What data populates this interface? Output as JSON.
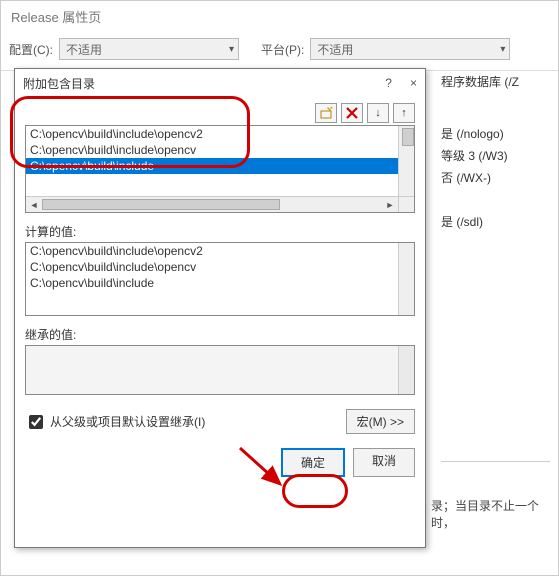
{
  "bg_window": {
    "title": "Release 属性页",
    "config_label": "配置(C):",
    "config_value": "不适用",
    "platform_label": "平台(P):",
    "platform_value": "不适用",
    "rows": {
      "r1": "程序数据库 (/Z",
      "r2": "是 (/nologo)",
      "r3": "等级 3 (/W3)",
      "r4": "否 (/WX-)",
      "r5": "是 (/sdl)"
    },
    "desc": "录；当目录不止一个时，"
  },
  "dialog": {
    "title": "附加包含目录",
    "help_icon": "?",
    "close_icon": "×",
    "toolbar": {
      "add_icon": "✳",
      "del_icon": "X",
      "down_icon": "↓",
      "up_icon": "↑"
    },
    "list": [
      "C:\\opencv\\build\\include\\opencv2",
      "C:\\opencv\\build\\include\\opencv",
      "C:\\opencv\\build\\include"
    ],
    "selected_index": 2,
    "calc_label": "计算的值:",
    "calc": [
      "C:\\opencv\\build\\include\\opencv2",
      "C:\\opencv\\build\\include\\opencv",
      "C:\\opencv\\build\\include"
    ],
    "inherit_label": "继承的值:",
    "inherit_check": "从父级或项目默认设置继承(I)",
    "macro_btn": "宏(M) >>",
    "ok": "确定",
    "cancel": "取消"
  }
}
